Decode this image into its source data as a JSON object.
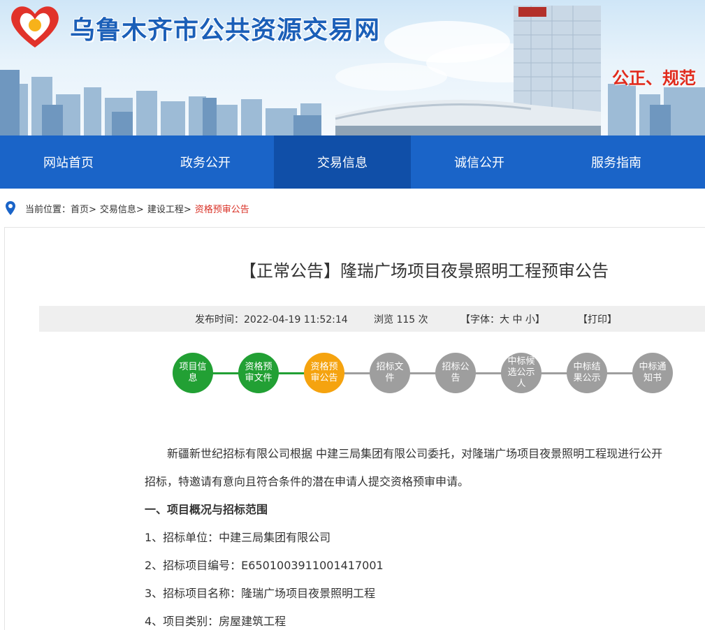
{
  "header": {
    "site_title": "乌鲁木齐市公共资源交易网",
    "slogan": "公正、规范"
  },
  "nav": {
    "items": [
      {
        "label": "网站首页"
      },
      {
        "label": "政务公开"
      },
      {
        "label": "交易信息"
      },
      {
        "label": "诚信公开"
      },
      {
        "label": "服务指南"
      }
    ],
    "active_index": 2
  },
  "breadcrumb": {
    "prefix": "当前位置：",
    "items": [
      "首页>",
      "交易信息>",
      "建设工程>"
    ],
    "current": "资格预审公告"
  },
  "article": {
    "title": "【正常公告】隆瑞广场项目夜景照明工程预审公告",
    "meta": {
      "publish_time": "发布时间：2022-04-19 11:52:14",
      "views": "浏览 115 次",
      "font_size": "【字体：大 中 小】",
      "print": "【打印】"
    },
    "steps": [
      {
        "label": "项目信息",
        "status": "done"
      },
      {
        "label": "资格预审文件",
        "status": "done"
      },
      {
        "label": "资格预审公告",
        "status": "current"
      },
      {
        "label": "招标文件",
        "status": "pending"
      },
      {
        "label": "招标公告",
        "status": "pending"
      },
      {
        "label": "中标候选公示人",
        "status": "pending"
      },
      {
        "label": "中标结果公示",
        "status": "pending"
      },
      {
        "label": "中标通知书",
        "status": "pending"
      }
    ],
    "paragraphs": [
      {
        "text": "　　新疆新世纪招标有限公司根据 中建三局集团有限公司委托，对隆瑞广场项目夜景照明工程现进行公开",
        "bold": false
      },
      {
        "text": "招标，特邀请有意向且符合条件的潜在申请人提交资格预审申请。",
        "bold": false
      },
      {
        "text": "一、项目概况与招标范围",
        "bold": true
      },
      {
        "text": "1、招标单位：中建三局集团有限公司",
        "bold": false
      },
      {
        "text": "2、招标项目编号：E6501003911001417001",
        "bold": false
      },
      {
        "text": "3、招标项目名称：隆瑞广场项目夜景照明工程",
        "bold": false
      },
      {
        "text": "4、项目类别：房屋建筑工程",
        "bold": false
      }
    ]
  },
  "colors": {
    "nav_bg": "#1a64c8",
    "nav_active": "#104fa8",
    "step_done": "#22a034",
    "step_current": "#f5a30f",
    "step_pending": "#9e9e9e",
    "breadcrumb_current": "#d93025",
    "slogan": "#e02b1d"
  }
}
